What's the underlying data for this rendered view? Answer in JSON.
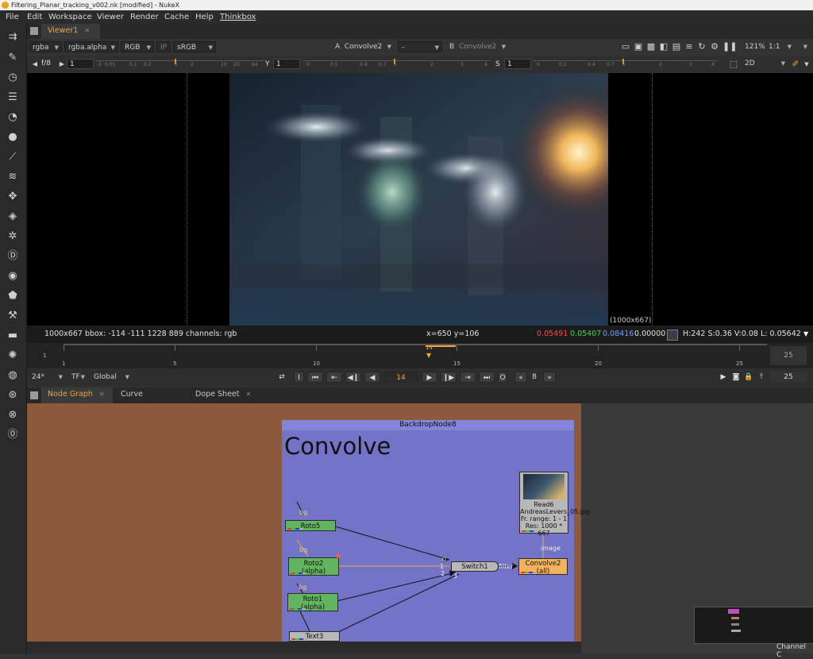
{
  "window": {
    "title": "Filtering_Planar_tracking_v002.nk [modified] - NukeX"
  },
  "menu": [
    "File",
    "Edit",
    "Workspace",
    "Viewer",
    "Render",
    "Cache",
    "Help",
    "Thinkbox"
  ],
  "viewer_tabs": [
    {
      "label": "Viewer1"
    }
  ],
  "viewer_controls": {
    "channels": "rgba",
    "alpha": "rgba.alpha",
    "display": "RGB",
    "ip": "IP",
    "lut": "sRGB",
    "a_label": "A",
    "a_input": "Convolve2",
    "a_op": "-",
    "b_label": "B",
    "b_input": "Convolve2",
    "zoom": "121%",
    "proxy": "1:1",
    "view": "2D"
  },
  "gain_row": {
    "fstop": "f/8",
    "gain_value": "1",
    "y_label": "Y",
    "y_value": "1",
    "s_label": "S",
    "s_value": "1"
  },
  "gain_ticks": [
    "-5",
    "0.01",
    "0.1",
    "0.2",
    "1",
    "2",
    "10",
    "20",
    "64"
  ],
  "gamma_ticks": [
    "0",
    "0.1",
    "0.4",
    "0.7",
    "1",
    "2",
    "3",
    "4"
  ],
  "sat_ticks": [
    "0",
    "0.1",
    "0.4",
    "0.7",
    "1",
    "2",
    "3",
    "4"
  ],
  "viewer": {
    "format_label": "(1000x667)"
  },
  "status": {
    "info": "1000x667  bbox: -114 -111 1228 889 channels: rgb",
    "coords": "x=650 y=106",
    "r": "0.05491",
    "g": "0.05407",
    "b": "0.08416",
    "a": "0.00000",
    "hsv": "H:242 S:0.36 V:0.08  L: 0.05642",
    "r_color": "#ff4a4a",
    "g_color": "#4cd44c",
    "b_color": "#6ea0ff"
  },
  "timeline": {
    "start": "1",
    "end": "25",
    "current": "14",
    "ticks": [
      "1",
      "5",
      "10",
      "15",
      "20",
      "25"
    ]
  },
  "playback": {
    "fps": "24*",
    "tf": "TF",
    "global": "Global",
    "frame": "14",
    "increment": "8",
    "end_frame": "25",
    "i_label": "I",
    "o_label": "O"
  },
  "bottom_tabs": [
    {
      "label": "Node Graph"
    },
    {
      "label": "Curve Editor"
    },
    {
      "label": "Dope Sheet"
    }
  ],
  "nodegraph": {
    "backdrop_name": "BackdropNode8",
    "backdrop_label": "Convolve",
    "nodes": {
      "roto5": "Roto5",
      "roto2": "Roto2",
      "roto2_sub": "(alpha)",
      "roto1": "Roto1",
      "roto1_sub": "(alpha)",
      "text3": "Text3",
      "switch1": "Switch1",
      "convolve2": "Convolve2",
      "convolve2_sub": "(all)",
      "read6": "Read6",
      "read6_file": "AndreasLevers_05.jpg",
      "read6_range": "Fr. range: 1 - 1",
      "read6_res": "Res: 1000 * 667"
    },
    "labels": {
      "bg1": "bg",
      "bg2": "bg",
      "bg3": "bg",
      "image": "image",
      "filter": "filter",
      "in0": "0",
      "in1": "1",
      "in2": "2",
      "in3": "3"
    },
    "channel_label": "Channel C"
  }
}
